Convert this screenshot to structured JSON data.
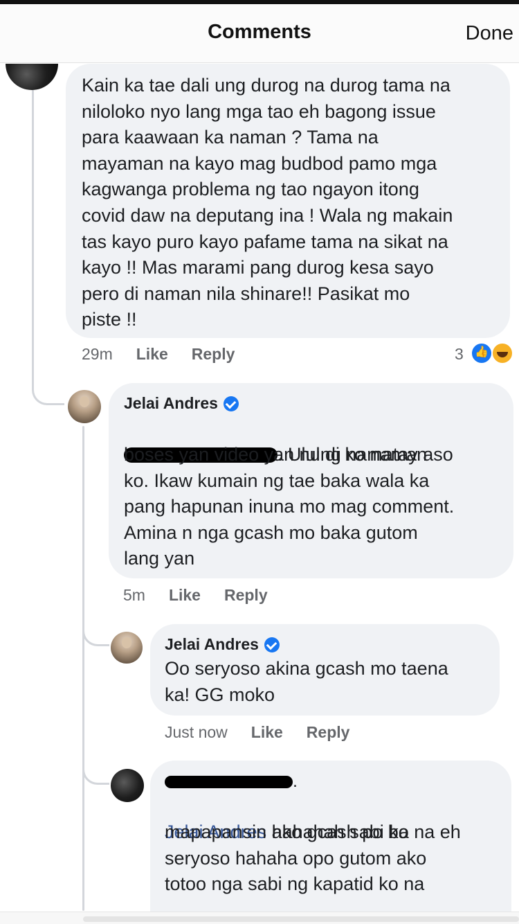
{
  "header": {
    "title": "Comments",
    "done_label": "Done"
  },
  "comments": [
    {
      "text": "Kain ka tae dali ung durog na durog tama na\nniloloko nyo lang mga tao eh bagong issue\npara kaawaan ka naman ? Tama na\nmayaman na kayo mag budbod pamo mga\nkagwanga problema ng tao ngayon itong\ncovid daw na deputang ina ! Wala ng makain\ntas kayo puro kayo pafame tama na sikat na\nkayo !! Mas marami pang durog kesa sayo\npero di naman nila shinare!! Pasikat mo\npiste !!",
      "time": "29m",
      "like": "Like",
      "reply": "Reply",
      "reaction_count": "3",
      "reactions": [
        "like-icon",
        "haha-icon"
      ]
    },
    {
      "author": "Jelai Andres",
      "text_after_mention": ". Ulul di ko naman",
      "text": "boses yan  video yan nung namatay aso\nko. Ikaw kumain ng tae baka wala ka\npang hapunan inuna mo mag comment.\nAmina n nga gcash mo baka gutom\nlang yan",
      "time": "5m",
      "like": "Like",
      "reply": "Reply"
    },
    {
      "author": "Jelai Andres",
      "text": "Oo seryoso akina gcash mo taena\nka! GG moko",
      "time": "Just now",
      "like": "Like",
      "reply": "Reply"
    },
    {
      "author_suffix": ".",
      "mention": "Jelai Andres",
      "text_after_mention": " hahahah sabi ko na eh",
      "text": "mapapansin ako gcash po ba\nseryoso hahaha opo gutom ako\ntotoo nga sabi ng kapatid ko na"
    }
  ]
}
